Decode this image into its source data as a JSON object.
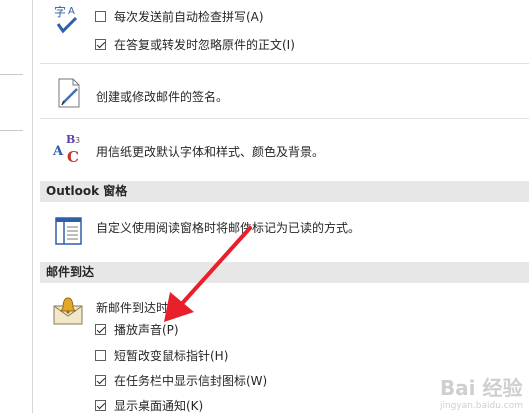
{
  "spelling": {
    "check_before_send": {
      "label": "每次发送前自动检查拼写(A)",
      "checked": false
    },
    "ignore_original_text": {
      "label": "在答复或转发时忽略原件的正文(I)",
      "checked": true
    },
    "icon_glyph": "字A"
  },
  "signature": {
    "description": "创建或修改邮件的签名。"
  },
  "stationery": {
    "description": "用信纸更改默认字体和样式、颜色及背景。",
    "icon_glyph": "ABC"
  },
  "reading_pane": {
    "section_title": "Outlook 窗格",
    "description": "自定义使用阅读窗格时将邮件标记为已读的方式。"
  },
  "arrival": {
    "section_title": "邮件到达",
    "heading": "新邮件到达时：",
    "options": [
      {
        "label": "播放声音(P)",
        "checked": true
      },
      {
        "label": "短暂改变鼠标指针(H)",
        "checked": false
      },
      {
        "label": "在任务栏中显示信封图标(W)",
        "checked": true
      },
      {
        "label": "显示桌面通知(K)",
        "checked": true
      }
    ]
  },
  "watermark": {
    "text": "Bai 经验",
    "sub": "jingyan.baidu.com"
  },
  "colors": {
    "annotation_arrow": "#e8202a",
    "section_bg": "#e7e7e7"
  }
}
